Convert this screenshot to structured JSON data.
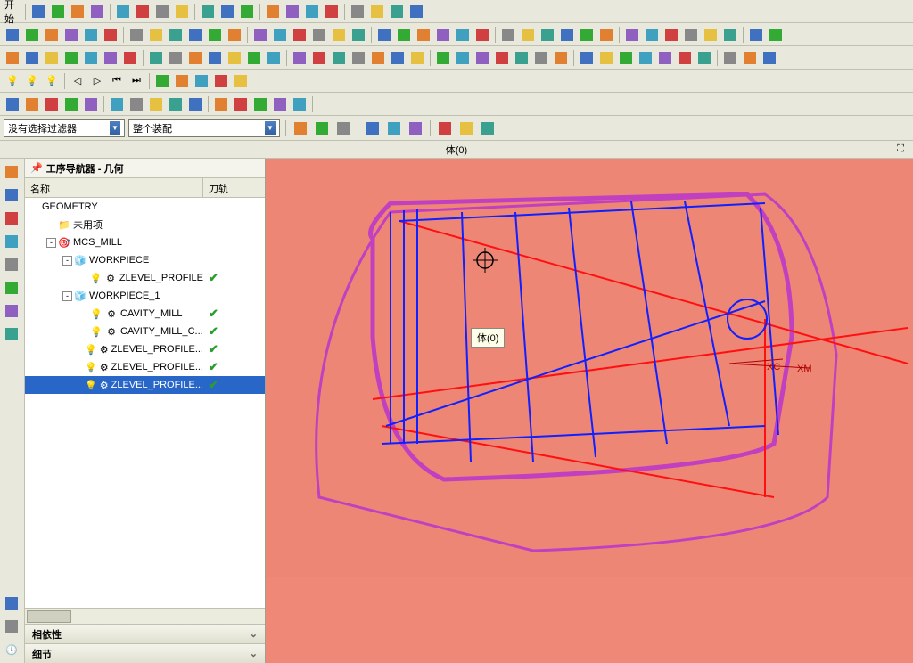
{
  "menu": {
    "start_label": "开始"
  },
  "filters": {
    "selection_filter": "没有选择过滤器",
    "assembly_filter": "整个装配"
  },
  "status": {
    "body_label": "体(0)"
  },
  "navigator": {
    "title": "工序导航器 - 几何",
    "col_name": "名称",
    "col_toolpath": "刀轨",
    "panels": {
      "dependency": "相依性",
      "detail": "细节"
    }
  },
  "tree": [
    {
      "label": "GEOMETRY",
      "indent": 0,
      "expander": "",
      "icon": "",
      "status": ""
    },
    {
      "label": "未用项",
      "indent": 1,
      "expander": "",
      "icon": "folder",
      "status": ""
    },
    {
      "label": "MCS_MILL",
      "indent": 1,
      "expander": "-",
      "icon": "mcs",
      "status": ""
    },
    {
      "label": "WORKPIECE",
      "indent": 2,
      "expander": "-",
      "icon": "wp",
      "status": ""
    },
    {
      "label": "ZLEVEL_PROFILE",
      "indent": 3,
      "expander": "",
      "icon": "op",
      "status": "check"
    },
    {
      "label": "WORKPIECE_1",
      "indent": 2,
      "expander": "-",
      "icon": "wp",
      "status": ""
    },
    {
      "label": "CAVITY_MILL",
      "indent": 3,
      "expander": "",
      "icon": "op",
      "status": "check"
    },
    {
      "label": "CAVITY_MILL_C...",
      "indent": 3,
      "expander": "",
      "icon": "op",
      "status": "check"
    },
    {
      "label": "ZLEVEL_PROFILE...",
      "indent": 3,
      "expander": "",
      "icon": "op",
      "status": "check"
    },
    {
      "label": "ZLEVEL_PROFILE...",
      "indent": 3,
      "expander": "",
      "icon": "op",
      "status": "check"
    },
    {
      "label": "ZLEVEL_PROFILE...",
      "indent": 3,
      "expander": "",
      "icon": "op",
      "status": "check",
      "selected": true
    }
  ],
  "viewport": {
    "tooltip": "体(0)",
    "axis_xc": "XC",
    "axis_xm": "XM"
  }
}
